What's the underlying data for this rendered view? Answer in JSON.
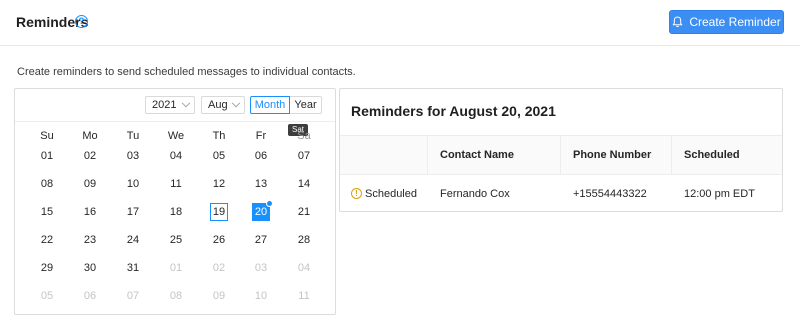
{
  "header": {
    "title": "Reminders",
    "help_icon": "?",
    "create_button_label": "Create Reminder",
    "accent_color": "#3b8ef3"
  },
  "description": "Create reminders to send scheduled messages to individual contacts.",
  "calendar": {
    "year": "2021",
    "month": "Aug",
    "modes": [
      "Month",
      "Year"
    ],
    "active_mode": "Month",
    "tooltip": "Sat",
    "weekdays": [
      "Su",
      "Mo",
      "Tu",
      "We",
      "Th",
      "Fr",
      "Sa"
    ],
    "weeks": [
      [
        "01",
        "02",
        "03",
        "04",
        "05",
        "06",
        "07"
      ],
      [
        "08",
        "09",
        "10",
        "11",
        "12",
        "13",
        "14"
      ],
      [
        "15",
        "16",
        "17",
        "18",
        "19",
        "20",
        "21"
      ],
      [
        "22",
        "23",
        "24",
        "25",
        "26",
        "27",
        "28"
      ],
      [
        "29",
        "30",
        "31",
        "01",
        "02",
        "03",
        "04"
      ],
      [
        "05",
        "06",
        "07",
        "08",
        "09",
        "10",
        "11"
      ]
    ],
    "today": "19",
    "selected": "20"
  },
  "reminders_panel": {
    "title": "Reminders for August 20, 2021",
    "columns": [
      "",
      "Contact Name",
      "Phone Number",
      "Scheduled"
    ],
    "rows": [
      {
        "status_icon": "warning-icon",
        "status": "Scheduled",
        "contact_name": "Fernando Cox",
        "phone_number": "+15554443322",
        "scheduled": "12:00 pm EDT"
      }
    ]
  }
}
